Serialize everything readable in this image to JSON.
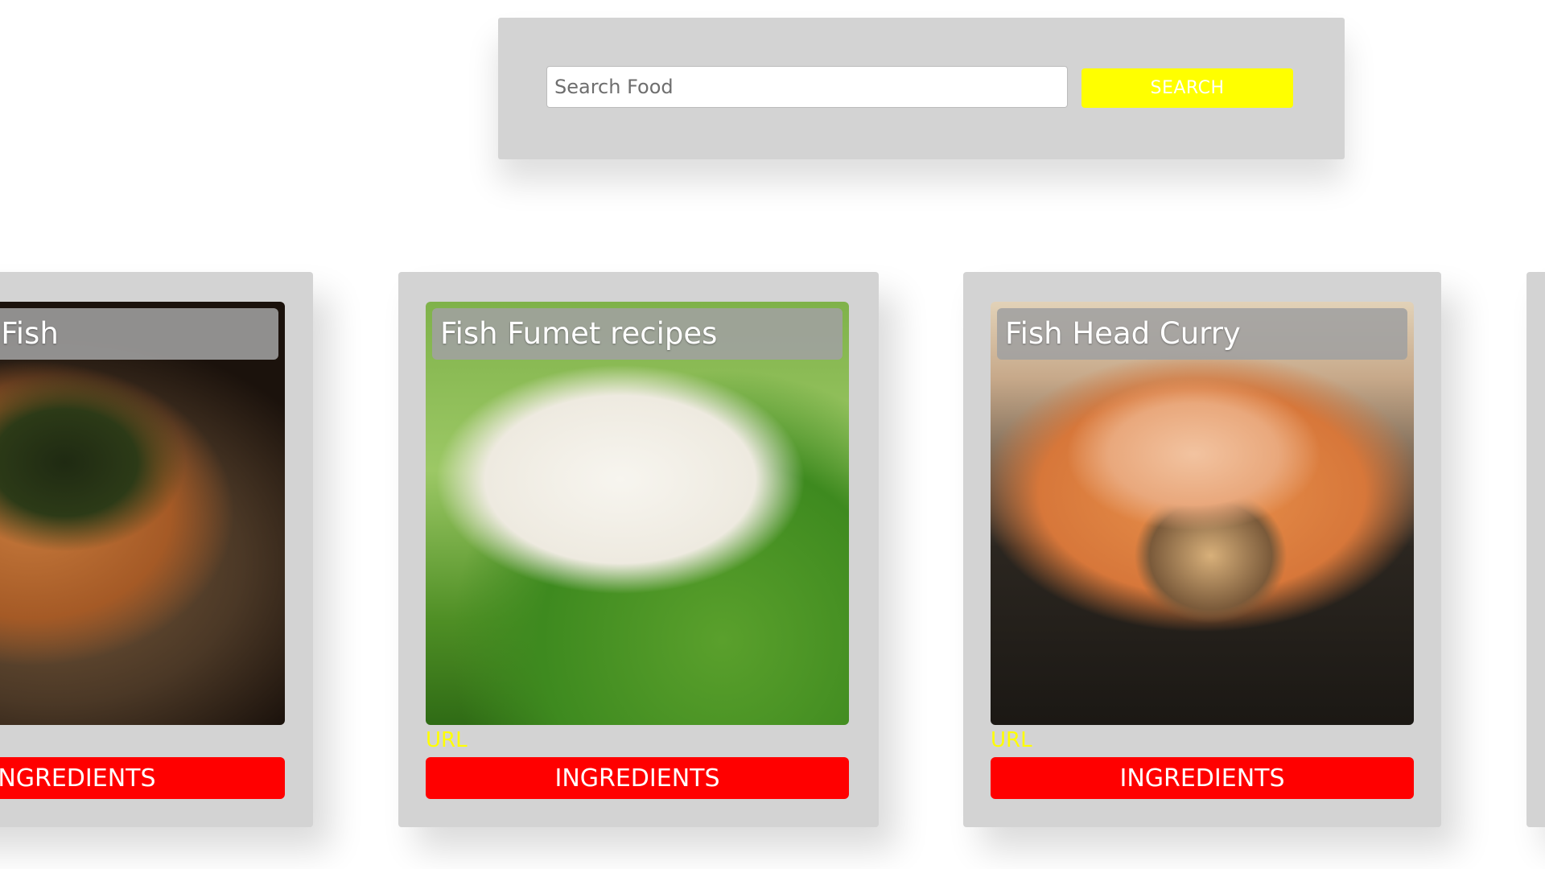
{
  "search": {
    "placeholder": "Search Food",
    "button_label": "SEARCH",
    "button_color": "#ffff00"
  },
  "cards": [
    {
      "title": "Scallion Fish",
      "url_label": "",
      "ingredients_label": "INGREDIENTS",
      "image": "scallion-fish-photo"
    },
    {
      "title": "Fish Fumet recipes",
      "url_label": "URL",
      "ingredients_label": "INGREDIENTS",
      "image": "fish-fumet-photo"
    },
    {
      "title": "Fish Head Curry",
      "url_label": "URL",
      "ingredients_label": "INGREDIENTS",
      "image": "fish-head-curry-photo"
    },
    {
      "title": "",
      "url_label": "",
      "ingredients_label": "",
      "image": "recipe-photo"
    }
  ],
  "colors": {
    "panel_bg": "#d3d3d3",
    "ingredients_button": "#ff0000",
    "url_text": "#ffff00",
    "title_bar": "#a0a0a0"
  }
}
